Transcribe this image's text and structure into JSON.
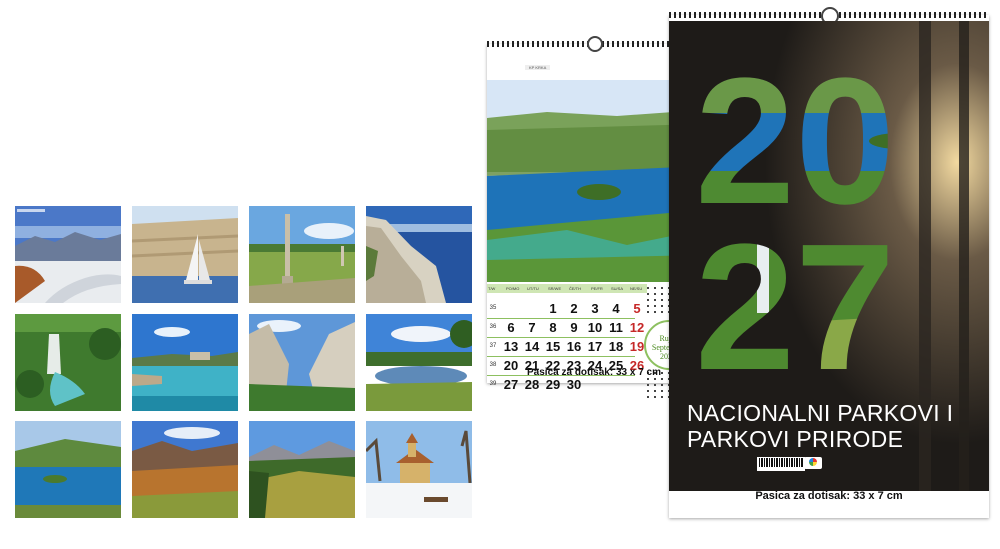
{
  "small_calendar": {
    "header_days": [
      "T/W",
      "PO/MO",
      "UT/TU",
      "SR/WE",
      "ČE/TH",
      "PE/FR",
      "SU/SA",
      "NE/SU"
    ],
    "week_numbers": [
      "35",
      "36",
      "37",
      "38",
      "39"
    ],
    "weeks": [
      [
        "",
        "",
        "1",
        "2",
        "3",
        "4",
        "5"
      ],
      [
        "6",
        "7",
        "8",
        "9",
        "10",
        "11",
        "12"
      ],
      [
        "13",
        "14",
        "15",
        "16",
        "17",
        "18",
        "19"
      ],
      [
        "20",
        "21",
        "22",
        "23",
        "24",
        "25",
        "26"
      ],
      [
        "27",
        "28",
        "29",
        "30",
        "",
        "",
        ""
      ]
    ],
    "month_hr": "Rujan",
    "month_en": "September",
    "year_label": "2027.",
    "caption": "Pasica za dotisak: 33 x 7 cm",
    "photo_label": "KP KRKA"
  },
  "big_calendar": {
    "year_part1": "20",
    "year_part2": "27",
    "title_line1": "NACIONALNI PARKOVI I",
    "title_line2": "PARKOVI PRIRODE",
    "caption": "Pasica za dotisak: 33 x 7 cm"
  },
  "colors": {
    "accent_green": "#8dc060",
    "sunday_red": "#c62828",
    "cover_dark": "#2a2622"
  },
  "thumbnails": [
    {
      "name": "snowy-mountain-road"
    },
    {
      "name": "sailboat-barren-island"
    },
    {
      "name": "stone-column-field"
    },
    {
      "name": "sea-cliffs"
    },
    {
      "name": "waterfall-lakes"
    },
    {
      "name": "turquoise-bay"
    },
    {
      "name": "canyon-rocks"
    },
    {
      "name": "lake-meadow"
    },
    {
      "name": "lake-island"
    },
    {
      "name": "autumn-hills"
    },
    {
      "name": "mountain-meadow"
    },
    {
      "name": "snowy-chapel"
    }
  ]
}
